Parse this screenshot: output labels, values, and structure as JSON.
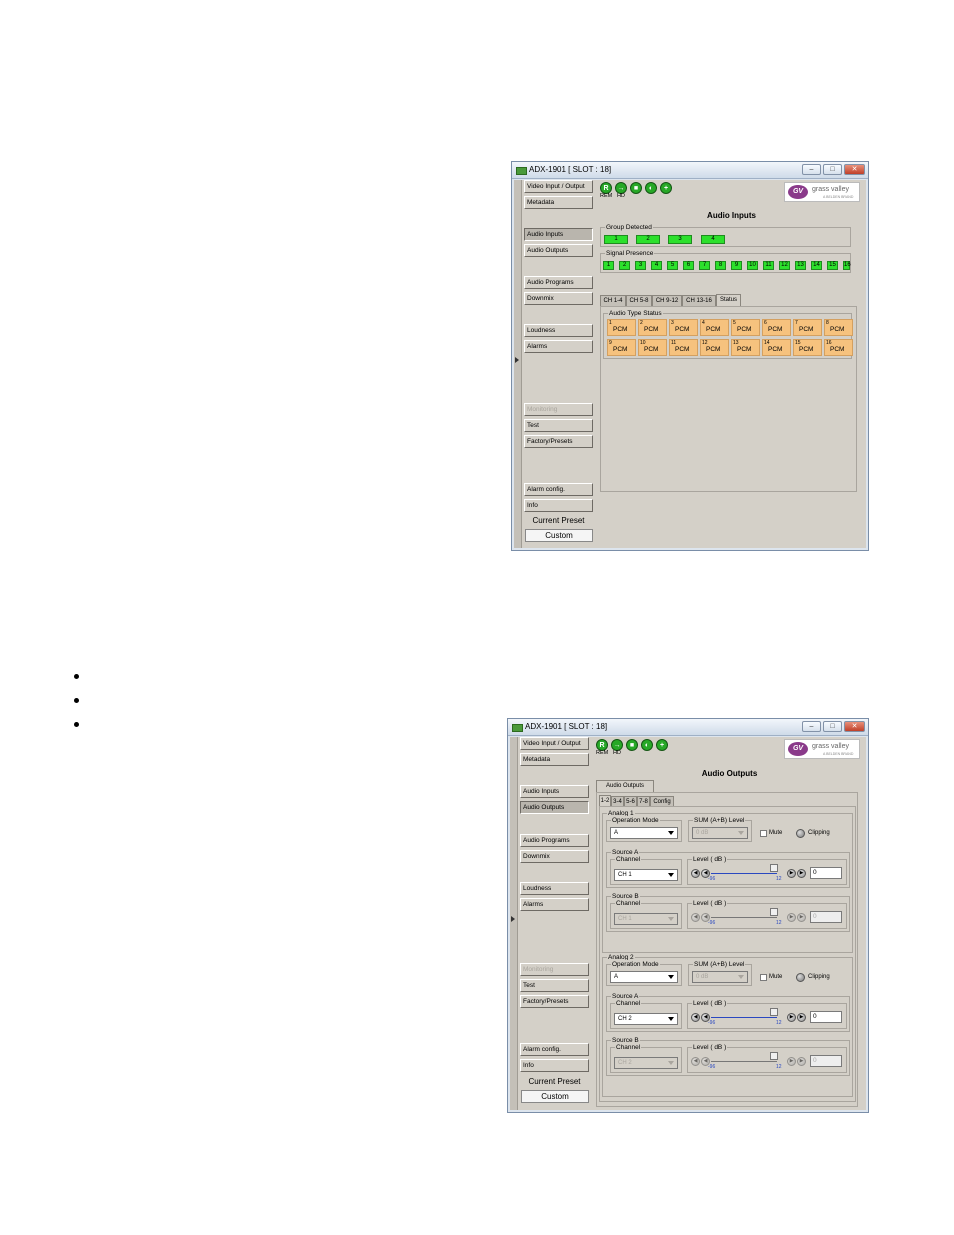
{
  "bullets": [
    "",
    "",
    ""
  ],
  "window1": {
    "title": "ADX-1901 [ SLOT : 18]",
    "status_icons": [
      {
        "glyph": "R"
      },
      {
        "glyph": "→"
      },
      {
        "glyph": "■"
      },
      {
        "glyph": "◐"
      },
      {
        "glyph": "+"
      }
    ],
    "status_labels": [
      "REM",
      "HD"
    ],
    "logo": {
      "text": "grass valley",
      "sub": "A BELDEN BRAND"
    },
    "nav": [
      {
        "label": "Video Input / Output"
      },
      {
        "label": "Metadata"
      },
      {
        "label": "Audio Inputs"
      },
      {
        "label": "Audio Outputs"
      },
      {
        "label": "Audio Programs"
      },
      {
        "label": "Downmix"
      },
      {
        "label": "Loudness"
      },
      {
        "label": "Alarms"
      },
      {
        "label": "Monitoring"
      },
      {
        "label": "Test"
      },
      {
        "label": "Factory/Presets"
      },
      {
        "label": "Alarm config."
      },
      {
        "label": "Info"
      }
    ],
    "current_preset_label": "Current Preset",
    "current_preset_value": "Custom",
    "heading": "Audio Inputs",
    "group_detected": {
      "title": "Group Detected",
      "items": [
        "1",
        "2",
        "3",
        "4"
      ]
    },
    "signal_presence": {
      "title": "Signal Presence",
      "items": [
        "1",
        "2",
        "3",
        "4",
        "5",
        "6",
        "7",
        "8",
        "9",
        "10",
        "11",
        "12",
        "13",
        "14",
        "15",
        "16"
      ]
    },
    "tabs": [
      "CH 1-4",
      "CH 5-8",
      "CH 9-12",
      "CH 13-16",
      "Status"
    ],
    "audio_type_status": {
      "title": "Audio Type Status",
      "channels": [
        {
          "n": "1",
          "v": "PCM"
        },
        {
          "n": "2",
          "v": "PCM"
        },
        {
          "n": "3",
          "v": "PCM"
        },
        {
          "n": "4",
          "v": "PCM"
        },
        {
          "n": "5",
          "v": "PCM"
        },
        {
          "n": "6",
          "v": "PCM"
        },
        {
          "n": "7",
          "v": "PCM"
        },
        {
          "n": "8",
          "v": "PCM"
        },
        {
          "n": "9",
          "v": "PCM"
        },
        {
          "n": "10",
          "v": "PCM"
        },
        {
          "n": "11",
          "v": "PCM"
        },
        {
          "n": "12",
          "v": "PCM"
        },
        {
          "n": "13",
          "v": "PCM"
        },
        {
          "n": "14",
          "v": "PCM"
        },
        {
          "n": "15",
          "v": "PCM"
        },
        {
          "n": "16",
          "v": "PCM"
        }
      ]
    }
  },
  "window2": {
    "title": "ADX-1901 [ SLOT : 18]",
    "heading": "Audio Outputs",
    "outer_tab": "Audio Outputs",
    "tabs": [
      "1-2",
      "3-4",
      "5-6",
      "7-8",
      "Config"
    ],
    "analogs": [
      {
        "title": "Analog 1",
        "operation_mode_label": "Operation Mode",
        "operation_mode": "A",
        "sum_label": "SUM (A+B) Level",
        "sum_value": "0 dB",
        "mute_label": "Mute",
        "clipping_label": "Clipping",
        "sources": [
          {
            "title": "Source A",
            "channel_label": "Channel",
            "channel": "CH 1",
            "level_label": "Level ( dB )",
            "min": "-96",
            "max": "12",
            "value": "0"
          },
          {
            "title": "Source B",
            "channel_label": "Channel",
            "channel": "CH 1",
            "level_label": "Level ( dB )",
            "min": "-96",
            "max": "12",
            "value": "0"
          }
        ]
      },
      {
        "title": "Analog 2",
        "operation_mode_label": "Operation Mode",
        "operation_mode": "A",
        "sum_label": "SUM (A+B) Level",
        "sum_value": "0 dB",
        "mute_label": "Mute",
        "clipping_label": "Clipping",
        "sources": [
          {
            "title": "Source A",
            "channel_label": "Channel",
            "channel": "CH 2",
            "level_label": "Level ( dB )",
            "min": "-96",
            "max": "12",
            "value": "0"
          },
          {
            "title": "Source B",
            "channel_label": "Channel",
            "channel": "CH 2",
            "level_label": "Level ( dB )",
            "min": "-96",
            "max": "12",
            "value": "0"
          }
        ]
      }
    ]
  },
  "colors": {
    "green": "#2ce02c",
    "pcm": "#f6c27e",
    "accent": "#2a48c0"
  }
}
